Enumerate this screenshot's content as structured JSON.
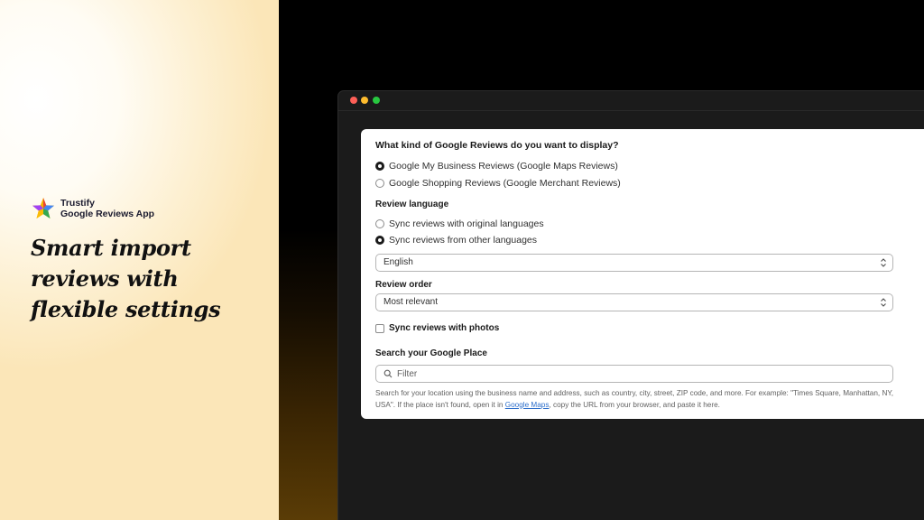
{
  "brand": {
    "name": "Trustify",
    "product": "Google Reviews App"
  },
  "headline": {
    "line1": "Smart import",
    "line2": "reviews with",
    "line3": "flexible settings"
  },
  "settings": {
    "review_type": {
      "question": "What kind of Google Reviews do you want to display?",
      "options": [
        {
          "label": "Google My Business Reviews (Google Maps Reviews)",
          "checked": true
        },
        {
          "label": "Google Shopping Reviews (Google Merchant Reviews)",
          "checked": false
        }
      ]
    },
    "review_language": {
      "label": "Review language",
      "options": [
        {
          "label": "Sync reviews with original languages",
          "checked": false
        },
        {
          "label": "Sync reviews from other languages",
          "checked": true
        }
      ],
      "selected_language": "English"
    },
    "review_order": {
      "label": "Review order",
      "selected": "Most relevant"
    },
    "sync_photos": {
      "label": "Sync reviews with photos",
      "checked": false
    },
    "search_place": {
      "label": "Search your Google Place",
      "placeholder": "Filter",
      "help_before": "Search for your location using the business name and address, such as country, city, street, ZIP code, and more. For example: \"Times Square, Manhattan, NY, USA\". If the place isn't found, open it in ",
      "help_link": "Google Maps",
      "help_after": ", copy the URL from your browser, and paste it here."
    }
  },
  "colors": {
    "link": "#2c6ecb",
    "window_close": "#fe5f57",
    "window_minimize": "#febc2e",
    "window_maximize": "#28c840"
  }
}
